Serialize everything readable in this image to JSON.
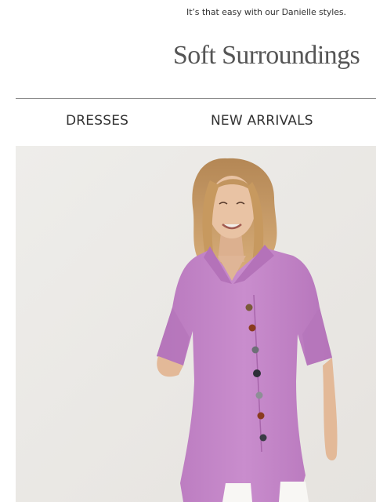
{
  "preheader": {
    "text": "It’s that easy with our Danielle styles."
  },
  "brand": {
    "logo_text": "Soft Surroundings"
  },
  "nav": {
    "items": [
      {
        "label": "DRESSES"
      },
      {
        "label": "NEW ARRIVALS"
      }
    ]
  },
  "hero": {
    "image_alt": "Woman wearing a lavender button-front tunic with white pants",
    "colors": {
      "background": "#eceae7",
      "tunic": "#c589c9",
      "tunic_shadow": "#b072b5",
      "hair": "#c79a66",
      "skin": "#e8c2a3",
      "pants": "#f7f6f3"
    }
  }
}
